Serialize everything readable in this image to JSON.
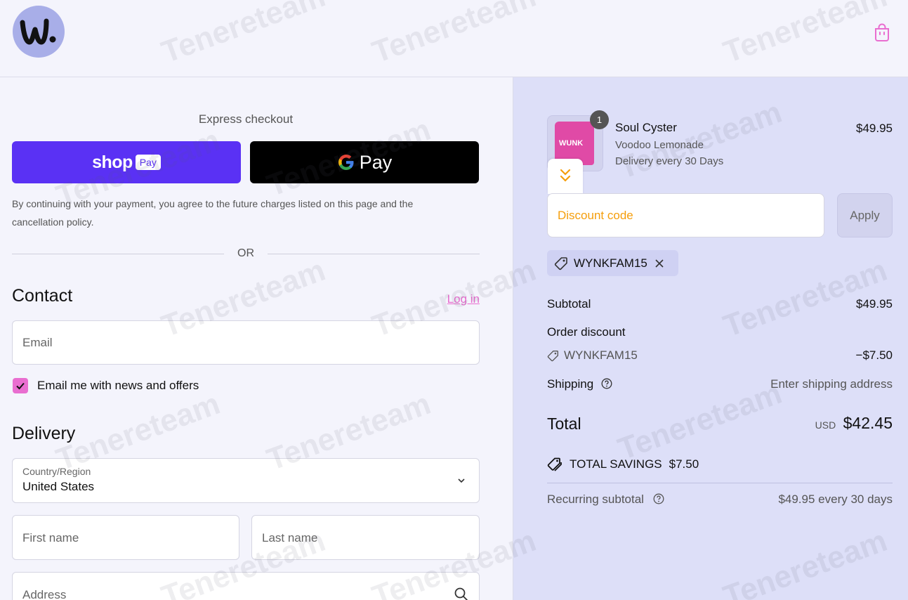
{
  "header": {
    "logo_text": "w.",
    "cart_icon": "shopping-bag-icon"
  },
  "express": {
    "title": "Express checkout",
    "shop_pay_word": "shop",
    "shop_pay_chip": "Pay",
    "gpay_word": "Pay",
    "legal": "By continuing with your payment, you agree to the future charges listed on this page and the cancellation policy.",
    "or": "OR"
  },
  "contact": {
    "title": "Contact",
    "login": "Log in",
    "email_placeholder": "Email",
    "newsletter_label": "Email me with news and offers",
    "newsletter_checked": true
  },
  "delivery": {
    "title": "Delivery",
    "country_label": "Country/Region",
    "country_value": "United States",
    "first_name_placeholder": "First name",
    "last_name_placeholder": "Last name",
    "address_placeholder": "Address"
  },
  "cart": {
    "quantity": "1",
    "thumb_text": "WUNK",
    "item_name": "Soul Cyster",
    "item_variant": "Voodoo Lemonade",
    "item_schedule": "Delivery every 30 Days",
    "item_price": "$49.95",
    "discount_placeholder": "Discount code",
    "apply_label": "Apply",
    "applied_code": "WYNKFAM15"
  },
  "summary": {
    "subtotal_label": "Subtotal",
    "subtotal_value": "$49.95",
    "order_discount_label": "Order discount",
    "discount_code": "WYNKFAM15",
    "discount_value": "−$7.50",
    "shipping_label": "Shipping",
    "shipping_value": "Enter shipping address",
    "total_label": "Total",
    "total_currency": "USD",
    "total_value": "$42.45",
    "savings_label": "TOTAL SAVINGS",
    "savings_value": "$7.50",
    "recurring_label": "Recurring subtotal",
    "recurring_value": "$49.95 every 30 days"
  },
  "watermark": "Tenereteam",
  "colors": {
    "accent_pink": "#e96ed0",
    "shop_pay": "#5a31f4",
    "discount_orange": "#f59e0b",
    "summary_bg": "#dddff8"
  }
}
